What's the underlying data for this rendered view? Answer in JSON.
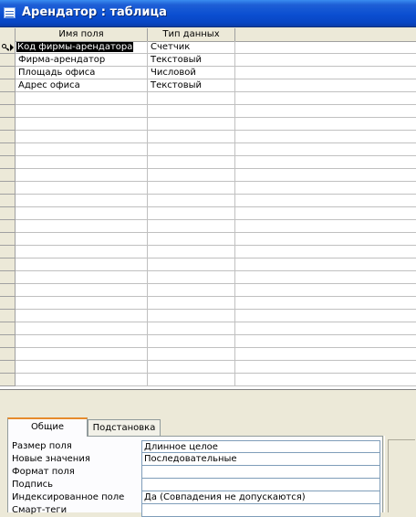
{
  "window": {
    "title": "Арендатор : таблица",
    "title_icon": "table-icon"
  },
  "grid": {
    "columns": {
      "name": "Имя поля",
      "type": "Тип данных",
      "description": ""
    },
    "rows": [
      {
        "name": "Код фирмы-арендатора",
        "type": "Счетчик",
        "is_key": true,
        "is_current": true
      },
      {
        "name": "Фирма-арендатор",
        "type": "Текстовый"
      },
      {
        "name": "Площадь офиса",
        "type": "Числовой"
      },
      {
        "name": "Адрес офиса",
        "type": "Текстовый"
      }
    ]
  },
  "properties": {
    "tabs": {
      "general": "Общие",
      "lookup": "Подстановка"
    },
    "rows": [
      {
        "label": "Размер поля",
        "value": "Длинное целое"
      },
      {
        "label": "Новые значения",
        "value": "Последовательные"
      },
      {
        "label": "Формат поля",
        "value": ""
      },
      {
        "label": "Подпись",
        "value": ""
      },
      {
        "label": "Индексированное поле",
        "value": "Да (Совпадения не допускаются)"
      },
      {
        "label": "Смарт-теги",
        "value": ""
      }
    ]
  }
}
